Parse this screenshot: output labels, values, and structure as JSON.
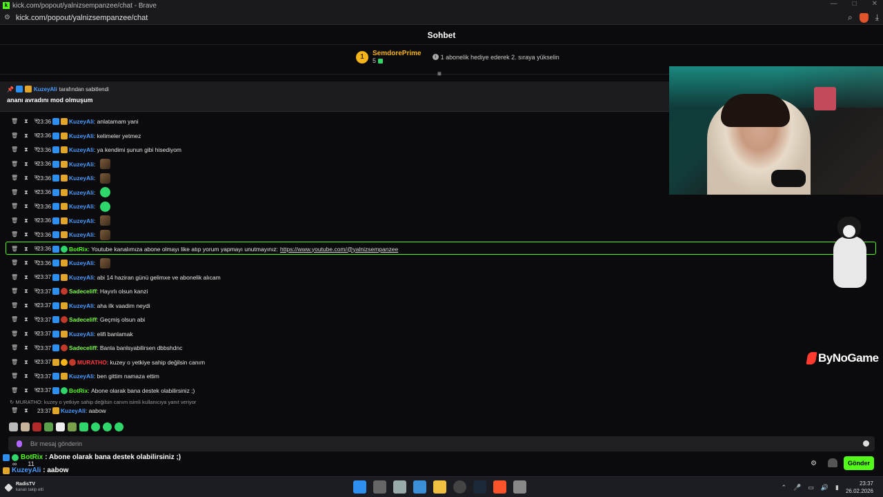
{
  "browser": {
    "title": "kick.com/popout/yalnizsempanzee/chat - Brave",
    "url": "kick.com/popout/yalnizsempanzee/chat"
  },
  "chat": {
    "header": "Sohbet",
    "top_gifter": {
      "rank": "1",
      "name": "SemdorePrime",
      "count": "5",
      "gift_prompt": "1 abonelik hediye ederek 2. sıraya yükselin"
    },
    "pinned": {
      "by_user": "KuzeyAli",
      "by_suffix": "tarafından sabitlendi",
      "text": "ananı avradını mod olmuşum"
    },
    "messages": [
      {
        "time": "23:36",
        "user": "KuzeyAli",
        "color": "blue",
        "text": "anlatamam yani"
      },
      {
        "time": "23:36",
        "user": "KuzeyAli",
        "color": "blue",
        "text": "kelimeler yetmez"
      },
      {
        "time": "23:36",
        "user": "KuzeyAli",
        "color": "blue",
        "text": "ya kendimi şunun gibi hisediyom"
      },
      {
        "time": "23:36",
        "user": "KuzeyAli",
        "color": "blue",
        "text": ""
      },
      {
        "time": "23:36",
        "user": "KuzeyAli",
        "color": "blue",
        "text": ""
      },
      {
        "time": "23:36",
        "user": "KuzeyAli",
        "color": "blue",
        "text": ""
      },
      {
        "time": "23:36",
        "user": "KuzeyAli",
        "color": "blue",
        "text": ""
      },
      {
        "time": "23:36",
        "user": "KuzeyAli",
        "color": "blue",
        "text": ""
      },
      {
        "time": "23:36",
        "user": "KuzeyAli",
        "color": "blue",
        "text": ""
      },
      {
        "time": "23:36",
        "user": "BotRix",
        "color": "green",
        "text": "Youtube kanalımıza abone olmayı like atıp yorum yapmayı unutmayınız:",
        "link": "https://www.youtube.com/@yalnizsempanzee"
      },
      {
        "time": "23:36",
        "user": "KuzeyAli",
        "color": "blue",
        "text": ""
      },
      {
        "time": "23:37",
        "user": "KuzeyAli",
        "color": "blue",
        "text": "abi 14 haziran günü gelimxe ve abonelik alıcam"
      },
      {
        "time": "23:37",
        "user": "Sadeceliff",
        "color": "lime",
        "text": "Hayırlı olsun kanzi"
      },
      {
        "time": "23:37",
        "user": "KuzeyAli",
        "color": "blue",
        "text": "aha ilk vaadim neydi"
      },
      {
        "time": "23:37",
        "user": "Sadeceliff",
        "color": "lime",
        "text": "Geçmiş olsun abi"
      },
      {
        "time": "23:37",
        "user": "KuzeyAli",
        "color": "blue",
        "text": "elifi banlamak"
      },
      {
        "time": "23:37",
        "user": "Sadeceliff",
        "color": "lime",
        "text": "Banla banlsyabilirsen dbbshdnc"
      },
      {
        "time": "23:37",
        "user": "MURATHO",
        "color": "red",
        "text": "kuzey o yetkiye sahip değilsin canım"
      },
      {
        "time": "23:37",
        "user": "KuzeyAli",
        "color": "blue",
        "text": "ben gittim namaza ettim"
      },
      {
        "time": "23:37",
        "user": "BotRix",
        "color": "green",
        "text": "Abone olarak bana destek olabilirsiniz ;)"
      }
    ],
    "reply_line": "MURATHO: kuzey o yetkiye sahip değilsin canım isimli kullanıcıya yanıt veriyor",
    "last_message": {
      "time": "23:37",
      "user": "KuzeyAli",
      "text": "aabow"
    },
    "input_placeholder": "Bir mesaj gönderin",
    "send_label": "Gönder",
    "overlay_line1_user": "BotRix",
    "overlay_line1_text": ": Abone olarak bana destek olabilirsiniz ;)",
    "overlay_line2_user": "KuzeyAli",
    "overlay_line2_text": ": aabow",
    "sub_count": "11"
  },
  "overlay": {
    "sponsor": "ByNoGame"
  },
  "taskbar": {
    "notif_title": "RadisTV",
    "notif_sub": "kanalı takip etti",
    "time": "23:37",
    "date": "26.02.2026"
  },
  "colors": {
    "kick_green": "#53fc18",
    "username_blue": "#4a9cff",
    "gold": "#f5b31a"
  }
}
